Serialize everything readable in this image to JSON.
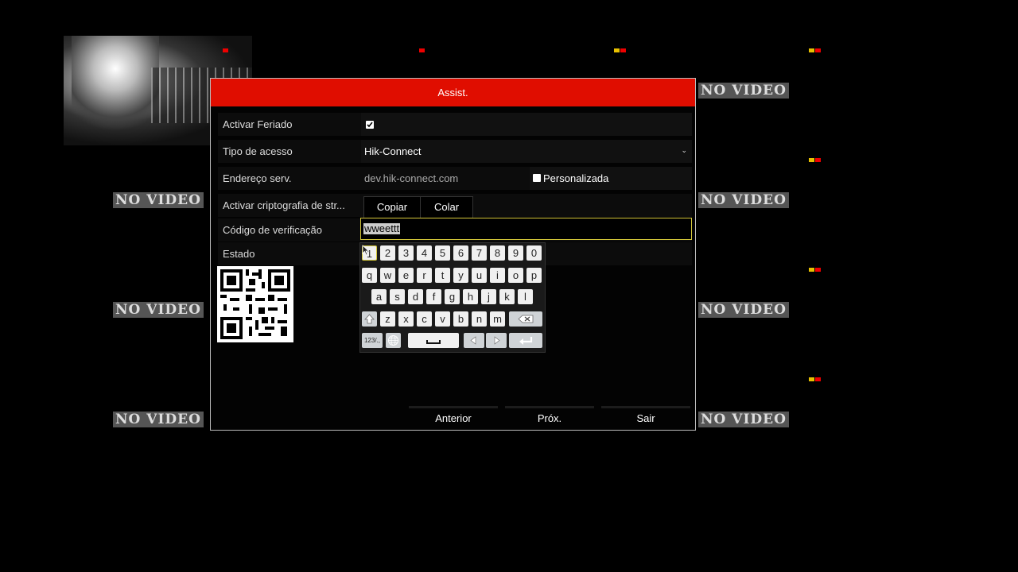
{
  "background": {
    "no_video_label": "NO VIDEO"
  },
  "dialog": {
    "title": "Assist.",
    "rows": {
      "holiday": {
        "label": "Activar Feriado",
        "checked": true
      },
      "access_type": {
        "label": "Tipo de acesso",
        "value": "Hik-Connect"
      },
      "server": {
        "label": "Endereço serv.",
        "value": "dev.hik-connect.com",
        "custom_label": "Personalizada",
        "custom_checked": false
      },
      "encryption": {
        "label": "Activar criptografia de str...",
        "copy_label": "Copiar",
        "paste_label": "Colar"
      },
      "verification": {
        "label": "Código de verificação",
        "value": "wweettt"
      },
      "status": {
        "label": "Estado"
      }
    },
    "footer": {
      "prev_label": "Anterior",
      "next_label": "Próx.",
      "exit_label": "Sair"
    }
  },
  "keyboard": {
    "row1": [
      "1",
      "2",
      "3",
      "4",
      "5",
      "6",
      "7",
      "8",
      "9",
      "0"
    ],
    "row2": [
      "q",
      "w",
      "e",
      "r",
      "t",
      "y",
      "u",
      "i",
      "o",
      "p"
    ],
    "row3": [
      "a",
      "s",
      "d",
      "f",
      "g",
      "h",
      "j",
      "k",
      "l"
    ],
    "row4": [
      "z",
      "x",
      "c",
      "v",
      "b",
      "n",
      "m"
    ],
    "mode_label": "123/.,",
    "icons": [
      "shift-icon",
      "backspace-icon",
      "globe-icon",
      "space-icon",
      "left-arrow-icon",
      "right-arrow-icon",
      "enter-icon"
    ]
  },
  "colors": {
    "title_bar": "#e00d00",
    "focus_border": "#d6c83a"
  }
}
